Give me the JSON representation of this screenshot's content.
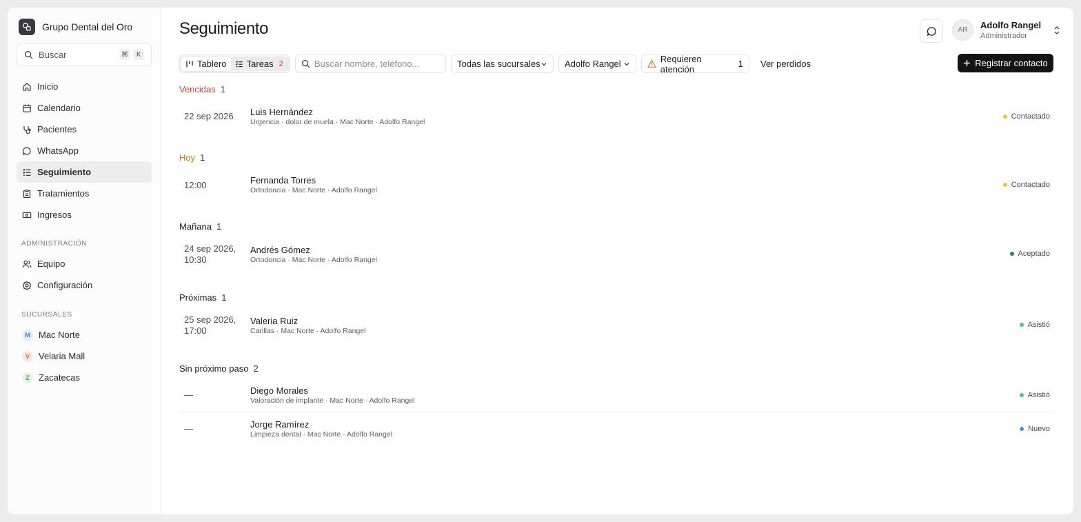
{
  "sidebar": {
    "brand": "Grupo Dental del Oro",
    "search": {
      "label": "Buscar",
      "kbd": [
        "⌘",
        "K"
      ]
    },
    "nav": [
      {
        "label": "Inicio",
        "icon": "home-icon"
      },
      {
        "label": "Calendario",
        "icon": "calendar-icon"
      },
      {
        "label": "Pacientes",
        "icon": "stethoscope-icon"
      },
      {
        "label": "WhatsApp",
        "icon": "chat-icon"
      },
      {
        "label": "Seguimiento",
        "icon": "list-check-icon",
        "active": true
      },
      {
        "label": "Tratamientos",
        "icon": "clipboard-icon"
      },
      {
        "label": "Ingresos",
        "icon": "banknote-icon"
      }
    ],
    "admin_label": "ADMINISTRACIÓN",
    "admin": [
      {
        "label": "Equipo",
        "icon": "users-icon"
      },
      {
        "label": "Configuración",
        "icon": "gear-icon"
      }
    ],
    "branches_label": "SUCURSALES",
    "branches": [
      {
        "label": "Mac Norte",
        "initial": "M",
        "bg": "#e3eefa",
        "fg": "#4b7fc2"
      },
      {
        "label": "Velaria Mall",
        "initial": "V",
        "bg": "#fbe7df",
        "fg": "#d2693f"
      },
      {
        "label": "Zacatecas",
        "initial": "Z",
        "bg": "#e3f4e6",
        "fg": "#4e9a5e"
      }
    ]
  },
  "header": {
    "title": "Seguimiento",
    "user": {
      "initials": "AR",
      "name": "Adolfo Rangel",
      "role": "Administrador"
    }
  },
  "toolbar": {
    "view_board": "Tablero",
    "view_tasks": "Tareas",
    "tasks_count": "2",
    "search_placeholder": "Buscar nombre, teléfono...",
    "branch_filter": "Todas las sucursales",
    "owner_filter": "Adolfo Rangel",
    "attention_label": "Requieren atención",
    "attention_count": "1",
    "lost_link": "Ver perdidos",
    "primary_action": "Registrar contacto"
  },
  "groups": [
    {
      "title": "Vencidas",
      "count": "1",
      "color": "#c8402f"
    },
    {
      "title": "Hoy",
      "count": "1",
      "color": "#c27a1a"
    },
    {
      "title": "Mañana",
      "count": "1",
      "color": "#1d1d1f"
    },
    {
      "title": "Próximas",
      "count": "1",
      "color": "#1d1d1f"
    },
    {
      "title": "Sin próximo paso",
      "count": "2",
      "color": "#1d1d1f"
    }
  ],
  "rows": [
    {
      "when": "22 sep 2026",
      "name": "Luis Hernández",
      "sub": "Urgencia · dolor de muela · Mac Norte · Adolfo Rangel",
      "status": "Contactado",
      "dot": "#e8c53a"
    },
    {
      "when": "12:00",
      "name": "Fernanda Torres",
      "sub": "Ortodoncia · Mac Norte · Adolfo Rangel",
      "status": "Contactado",
      "dot": "#e8c53a"
    },
    {
      "when": "24 sep 2026, 10:30",
      "name": "Andrés Gómez",
      "sub": "Ortodoncia · Mac Norte · Adolfo Rangel",
      "status": "Aceptado",
      "dot": "#2f8a3f"
    },
    {
      "when": "25 sep 2026, 17:00",
      "name": "Valeria Ruiz",
      "sub": "Carillas · Mac Norte · Adolfo Rangel",
      "status": "Asistió",
      "dot": "#5cc076"
    },
    {
      "when": "—",
      "name": "Diego Morales",
      "sub": "Valoración de implante · Mac Norte · Adolfo Rangel",
      "status": "Asistió",
      "dot": "#5cc076"
    },
    {
      "when": "—",
      "name": "Jorge Ramírez",
      "sub": "Limpieza dental · Mac Norte · Adolfo Rangel",
      "status": "Nuevo",
      "dot": "#4a90d9"
    }
  ]
}
